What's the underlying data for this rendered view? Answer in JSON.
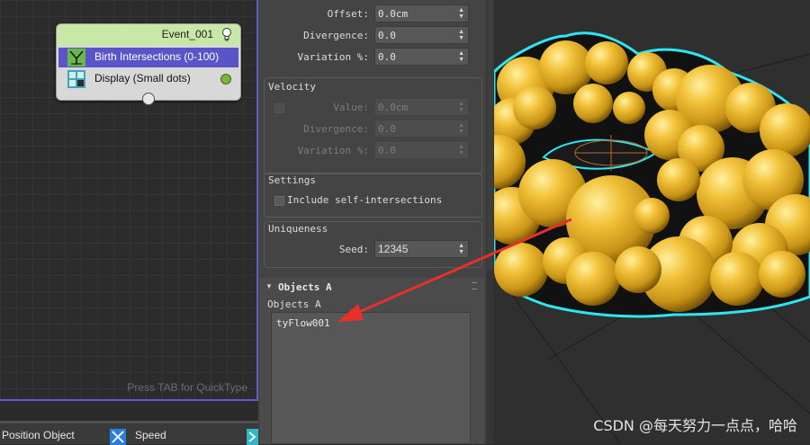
{
  "flow": {
    "event": {
      "title": "Event_001",
      "operators": [
        {
          "label": "Birth Intersections (0-100)",
          "icon": "birth-intersections-icon",
          "selected": true
        },
        {
          "label": "Display (Small dots)",
          "icon": "display-icon",
          "selected": false
        }
      ],
      "display_color": "#7ab43a"
    },
    "hint": "Press TAB for QuickType",
    "depot": [
      {
        "label": "Position Object",
        "icon": "position-object-icon"
      },
      {
        "label": "Speed",
        "icon": "speed-icon"
      }
    ]
  },
  "panel": {
    "top_rows": [
      {
        "label": "Offset:",
        "value": "0.0cm"
      },
      {
        "label": "Divergence:",
        "value": "0.0"
      },
      {
        "label": "Variation %:",
        "value": "0.0"
      }
    ],
    "velocity": {
      "title": "Velocity",
      "enabled": false,
      "rows": [
        {
          "label": "Value:",
          "value": "0.0cm"
        },
        {
          "label": "Divergence:",
          "value": "0.0"
        },
        {
          "label": "Variation %:",
          "value": "0.0"
        }
      ]
    },
    "settings": {
      "title": "Settings",
      "include_self_intersections": "Include self-intersections",
      "checked": false
    },
    "uniqueness": {
      "title": "Uniqueness",
      "seed_label": "Seed:",
      "seed_value": "12345"
    },
    "objects_rollout": {
      "title": "Objects A",
      "list_label": "Objects A",
      "items": [
        "tyFlow001"
      ]
    }
  },
  "viewport": {
    "watermark": "CSDN @每天努力一点点，哈哈",
    "sphere_color": "#e8b22a",
    "outline_color": "#2ee6f0"
  },
  "annotation": {
    "arrow_color": "#e8302a"
  }
}
